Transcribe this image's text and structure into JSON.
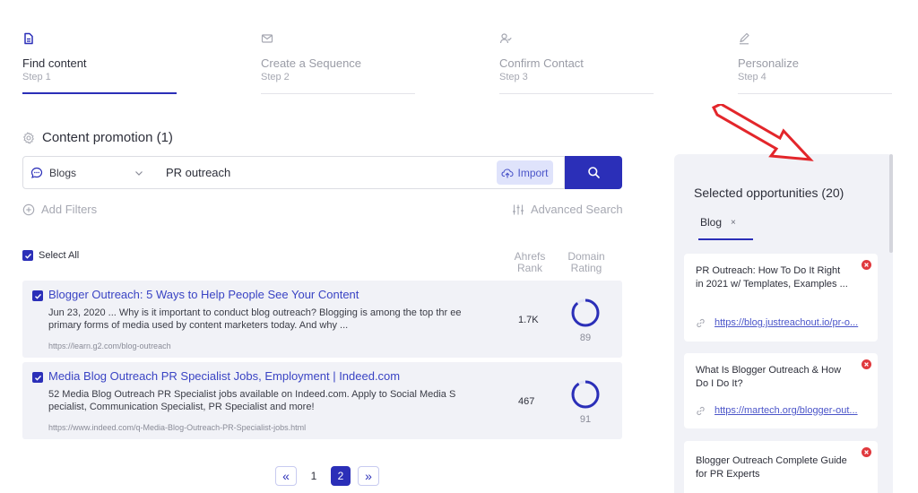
{
  "steps": [
    {
      "title": "Find content",
      "sub": "Step 1",
      "icon": "document-icon",
      "active": true
    },
    {
      "title": "Create a Sequence",
      "sub": "Step 2",
      "icon": "envelope-icon",
      "active": false
    },
    {
      "title": "Confirm Contact",
      "sub": "Step 3",
      "icon": "user-check-icon",
      "active": false
    },
    {
      "title": "Personalize",
      "sub": "Step 4",
      "icon": "pen-icon",
      "active": false
    }
  ],
  "section": {
    "title": "Content promotion (1)",
    "icon": "gear-icon"
  },
  "search": {
    "source": "Blogs",
    "query": "PR outreach",
    "import_label": "Import"
  },
  "filters": {
    "add_label": "Add Filters",
    "advanced_label": "Advanced Search"
  },
  "table": {
    "select_all": "Select All",
    "col_rank": "Ahrefs Rank",
    "col_rank_l1": "Ahrefs",
    "col_rank_l2": "Rank",
    "col_dr_l1": "Domain",
    "col_dr_l2": "Rating"
  },
  "results": [
    {
      "title": "Blogger Outreach: 5 Ways to Help People See Your Content",
      "desc": "Jun 23, 2020 ... Why is it important to conduct blog outreach? Blogging is among the top thr ee primary forms of media used by content marketers today. And why ...",
      "url": "https://learn.g2.com/blog-outreach",
      "rank": "1.7K",
      "dr": "89",
      "dr_value": 89,
      "checked": true
    },
    {
      "title": "Media Blog Outreach PR Specialist Jobs, Employment | Indeed.com",
      "desc": "52 Media Blog Outreach PR Specialist jobs available on Indeed.com. Apply to Social Media S pecialist, Communication Specialist, PR Specialist and more!",
      "url": "https://www.indeed.com/q-Media-Blog-Outreach-PR-Specialist-jobs.html",
      "rank": "467",
      "dr": "91",
      "dr_value": 91,
      "checked": true
    }
  ],
  "pagination": {
    "prev": "«",
    "pages": [
      "1",
      "2"
    ],
    "current": "2",
    "next": "»"
  },
  "panel": {
    "title": "Selected opportunities (20)",
    "tab": "Blog",
    "tab_close": "×",
    "items": [
      {
        "title": "PR Outreach: How To Do It Right in 2021 w/ Templates, Examples ...",
        "link": "https://blog.justreachout.io/pr-o..."
      },
      {
        "title": "What Is Blogger Outreach & How Do I Do It?",
        "link": "https://martech.org/blogger-out..."
      },
      {
        "title": "Blogger Outreach Complete Guide for PR Experts",
        "link": ""
      }
    ]
  },
  "colors": {
    "accent": "#2b2fb8",
    "link": "#3a44c4",
    "remove": "#e0393e",
    "annotation": "#e3262b"
  }
}
